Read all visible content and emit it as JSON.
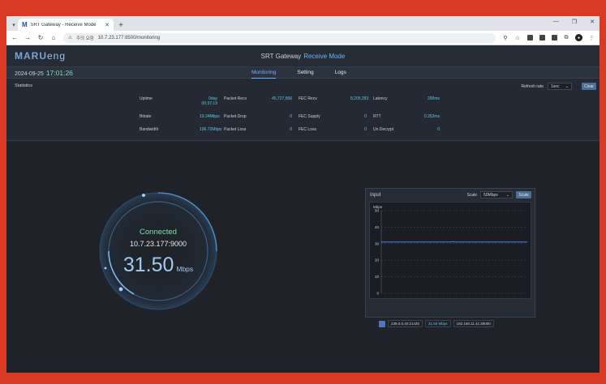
{
  "browser": {
    "tab_title": "SRT Gateway - Receive Mode",
    "tab_logo": "M",
    "new_tab": "+",
    "security_label": "주의 요함",
    "url": "10.7.23.177:8500/monitoring"
  },
  "header": {
    "logo_main": "MARU",
    "logo_sub": "eng",
    "title": "SRT Gateway",
    "mode": "Receive Mode"
  },
  "status_bar": {
    "date": "2024-09-25",
    "time": "17:01:26"
  },
  "nav": {
    "items": [
      {
        "label": "Monitoring",
        "active": true
      },
      {
        "label": "Setting",
        "active": false
      },
      {
        "label": "Logs",
        "active": false
      }
    ]
  },
  "statistics": {
    "label": "Statistics",
    "refresh_label": "Refresh rate",
    "refresh_value": "1sec",
    "refresh_button": "Clear",
    "rows": [
      [
        {
          "key": "Uptime",
          "value": "0day 00:37:19"
        },
        {
          "key": "Packet Recv",
          "value": "45,727,566"
        },
        {
          "key": "FEC Recv",
          "value": "8,205,283"
        },
        {
          "key": "Latency",
          "value": "200ms"
        }
      ],
      [
        {
          "key": "Bitrate",
          "value": "19.24Mbps"
        },
        {
          "key": "Packet Drop",
          "value": "0"
        },
        {
          "key": "FEC Supply",
          "value": "0"
        },
        {
          "key": "RTT",
          "value": "0.253ms"
        }
      ],
      [
        {
          "key": "Bandwidth",
          "value": "196.72Mbps"
        },
        {
          "key": "Packet Loss",
          "value": "0"
        },
        {
          "key": "FEC Loss",
          "value": "0"
        },
        {
          "key": "Un Decrypt",
          "value": "0"
        }
      ]
    ]
  },
  "gauge": {
    "status": "Connected",
    "address": "10.7.23.177:9000",
    "rate": "31.50",
    "unit": "Mbps"
  },
  "input_panel": {
    "title": "Input",
    "scale_label": "Scale",
    "scale_value": "50Mbps",
    "scale_button": "Scale"
  },
  "chart_data": {
    "type": "line",
    "ylabel": "Mbps",
    "ylim": [
      0,
      50
    ],
    "yticks": [
      0,
      10,
      20,
      30,
      40,
      50
    ],
    "grid": true,
    "series": [
      {
        "values": [
          31,
          31,
          31,
          31,
          31,
          31,
          31,
          31,
          31,
          31,
          31,
          31,
          31,
          31,
          31,
          31,
          31,
          31,
          31,
          31,
          31,
          31,
          31,
          31,
          31.2,
          31,
          31,
          31,
          31,
          31,
          31,
          31,
          31,
          31,
          31,
          31,
          31,
          31,
          31,
          31,
          31,
          31,
          31,
          31,
          31,
          31,
          31,
          31,
          31,
          31
        ]
      }
    ],
    "color": "#4e7fe0"
  },
  "info_bar": {
    "address": "239.0.0.40:21420",
    "rate": "31.50 Mbps",
    "source": "192.168.11.41:28000"
  }
}
